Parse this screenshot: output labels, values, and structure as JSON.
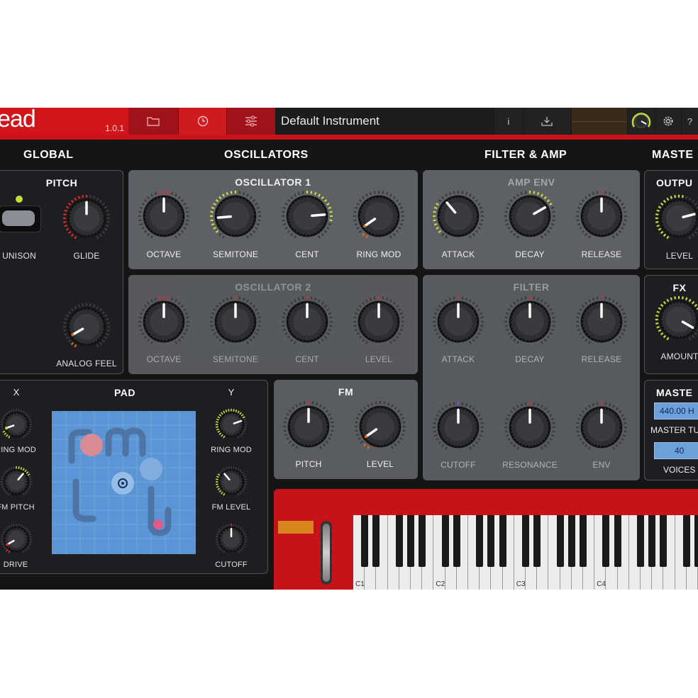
{
  "app": {
    "logo": "ead",
    "version": "1.0.1",
    "preset_name": "Default Instrument"
  },
  "toolbar": {
    "folder_icon": "folder-icon",
    "clock_icon": "clock-icon",
    "sliders_icon": "sliders-icon",
    "info_label": "i",
    "save_icon": "download-icon",
    "gear_icon": "gear-icon",
    "help_label": "?"
  },
  "sections": {
    "global": "GLOBAL",
    "oscillators": "OSCILLATORS",
    "filter_amp": "FILTER & AMP",
    "master": "MASTE"
  },
  "pitch": {
    "title": "PITCH",
    "unison": "UNISON",
    "glide": "GLIDE",
    "analog_feel": "ANALOG FEEL"
  },
  "osc1": {
    "title": "OSCILLATOR 1",
    "octave": "OCTAVE",
    "semitone": "SEMITONE",
    "cent": "CENT",
    "ring_mod": "RING MOD"
  },
  "osc2": {
    "title": "OSCILLATOR 2",
    "octave": "OCTAVE",
    "semitone": "SEMITONE",
    "cent": "CENT",
    "level": "LEVEL"
  },
  "amp_env": {
    "title": "AMP ENV",
    "attack": "ATTACK",
    "decay": "DECAY",
    "release": "RELEASE"
  },
  "filter": {
    "title": "FILTER",
    "attack": "ATTACK",
    "decay": "DECAY",
    "release": "RELEASE",
    "cutoff": "CUTOFF",
    "resonance": "RESONANCE",
    "env": "ENV"
  },
  "output": {
    "title": "OUTPU",
    "level": "LEVEL"
  },
  "fx": {
    "title": "FX",
    "amount": "AMOUNT"
  },
  "master": {
    "title": "MASTE",
    "tune_value": "440.00 H",
    "tune_label": "MASTER TU",
    "voices_value": "40",
    "voices_label": "VOICES"
  },
  "pad": {
    "title": "PAD",
    "x": "X",
    "y": "Y",
    "x_ring_mod": "RING MOD",
    "x_fm_pitch": "FM PITCH",
    "x_drive": "DRIVE",
    "y_ring_mod": "RING MOD",
    "y_fm_level": "FM LEVEL",
    "y_cutoff": "CUTOFF"
  },
  "fm": {
    "title": "FM",
    "pitch": "PITCH",
    "level": "LEVEL"
  },
  "keyboard": {
    "labels": [
      "C1",
      "C2",
      "C3",
      "C4"
    ]
  },
  "colors": {
    "accent_red": "#d0161b",
    "panel_gray": "#5d6064",
    "panel_dark": "#1d1e21",
    "arc_yellow": "#c8dc3a",
    "arc_orange": "#e06a1a",
    "arc_red": "#e0282a",
    "pad_blue": "#5b95d6"
  }
}
